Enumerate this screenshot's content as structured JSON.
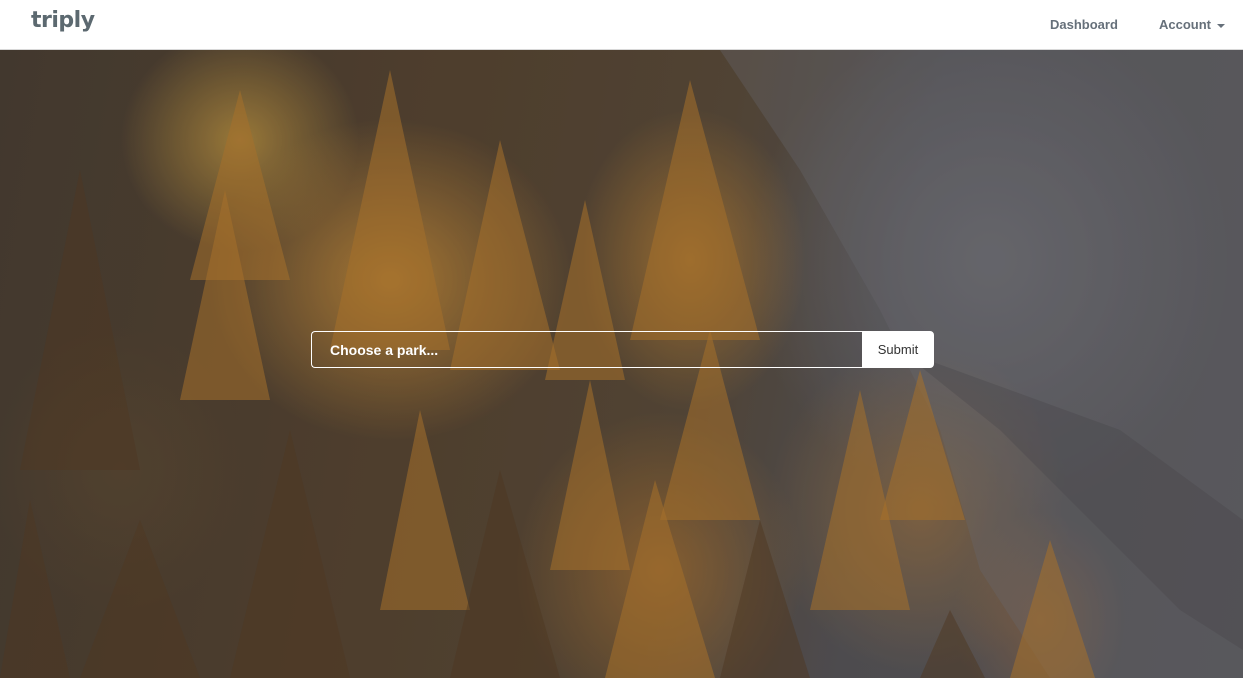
{
  "navbar": {
    "brand": "triply",
    "links": {
      "dashboard": "Dashboard",
      "account": "Account"
    }
  },
  "search": {
    "placeholder": "Choose a park...",
    "value": "",
    "submit_label": "Submit"
  },
  "colors": {
    "navbar_background": "#ffffff",
    "nav_text": "#66707a",
    "brand_text": "#5c6970",
    "submit_background": "#ffffff"
  },
  "icons": {
    "account_dropdown": "caret-down-icon"
  }
}
